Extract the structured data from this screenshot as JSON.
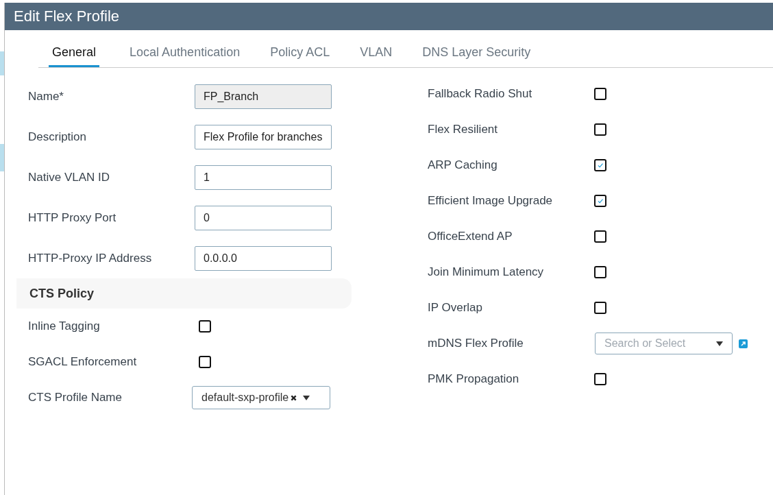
{
  "dialog": {
    "title": "Edit Flex Profile"
  },
  "tabs": [
    {
      "label": "General",
      "selected": true
    },
    {
      "label": "Local Authentication",
      "selected": false
    },
    {
      "label": "Policy ACL",
      "selected": false
    },
    {
      "label": "VLAN",
      "selected": false
    },
    {
      "label": "DNS Layer Security",
      "selected": false
    }
  ],
  "left_fields": [
    {
      "label": "Name*",
      "value": "FP_Branch",
      "disabled": true
    },
    {
      "label": "Description",
      "value": "Flex Profile for branches",
      "disabled": false
    },
    {
      "label": "Native VLAN ID",
      "value": "1",
      "disabled": false
    },
    {
      "label": "HTTP Proxy Port",
      "value": "0",
      "disabled": false
    },
    {
      "label": "HTTP-Proxy IP Address",
      "value": "0.0.0.0",
      "disabled": false
    }
  ],
  "cts_policy": {
    "title": "CTS Policy",
    "items": [
      {
        "kind": "checkbox",
        "label": "Inline Tagging",
        "checked": false
      },
      {
        "kind": "checkbox",
        "label": "SGACL Enforcement",
        "checked": false
      },
      {
        "kind": "select",
        "label": "CTS Profile Name",
        "value": "default-sxp-profile"
      }
    ]
  },
  "right_items": [
    {
      "kind": "checkbox",
      "label": "Fallback Radio Shut",
      "checked": false
    },
    {
      "kind": "checkbox",
      "label": "Flex Resilient",
      "checked": false
    },
    {
      "kind": "checkbox",
      "label": "ARP Caching",
      "checked": true
    },
    {
      "kind": "checkbox",
      "label": "Efficient Image Upgrade",
      "checked": true
    },
    {
      "kind": "checkbox",
      "label": "OfficeExtend AP",
      "checked": false
    },
    {
      "kind": "checkbox",
      "label": "Join Minimum Latency",
      "checked": false
    },
    {
      "kind": "checkbox",
      "label": "IP Overlap",
      "checked": false
    },
    {
      "kind": "search_select",
      "label": "mDNS Flex Profile",
      "placeholder": "Search or Select"
    },
    {
      "kind": "checkbox",
      "label": "PMK Propagation",
      "checked": false
    }
  ]
}
